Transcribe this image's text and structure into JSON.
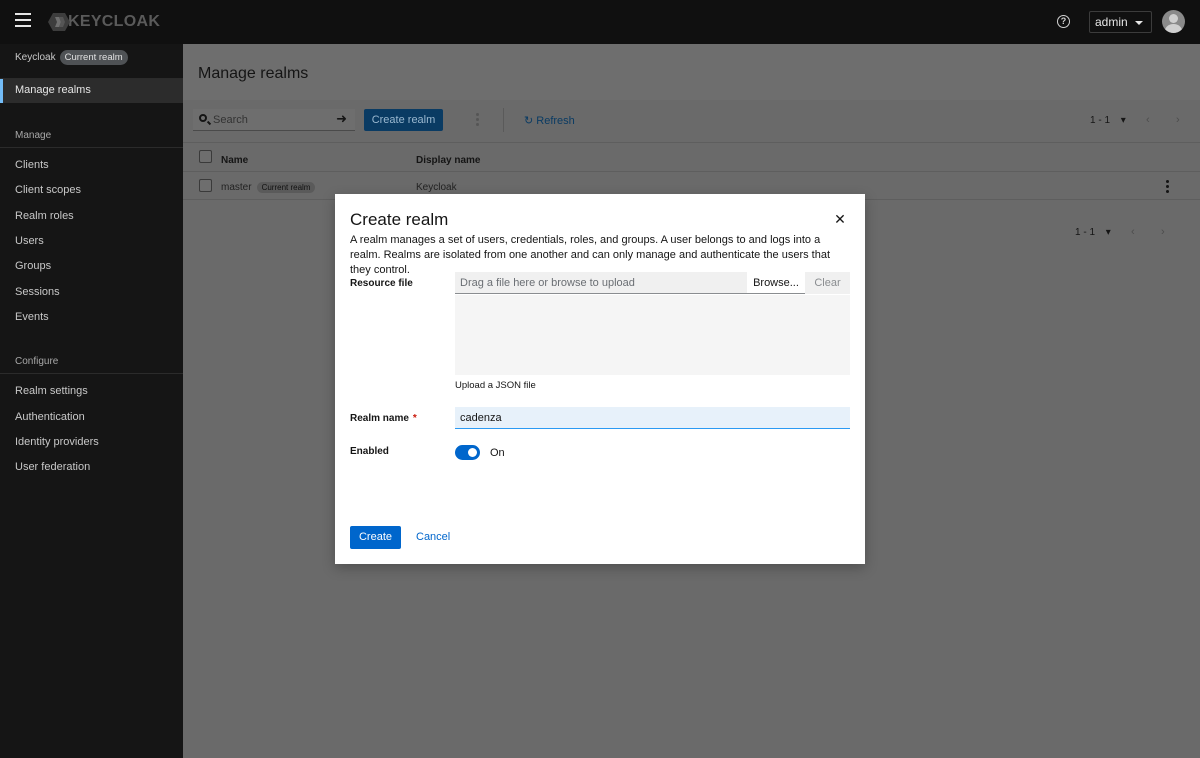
{
  "masthead": {
    "brand": "KEYCLOAK",
    "user": "admin"
  },
  "sidebar": {
    "realm_name": "Keycloak",
    "realm_badge": "Current realm",
    "active_item": "Manage realms",
    "sections": [
      {
        "title": "Manage",
        "items": [
          "Clients",
          "Client scopes",
          "Realm roles",
          "Users",
          "Groups",
          "Sessions",
          "Events"
        ]
      },
      {
        "title": "Configure",
        "items": [
          "Realm settings",
          "Authentication",
          "Identity providers",
          "User federation"
        ]
      }
    ]
  },
  "main": {
    "title": "Manage realms",
    "toolbar": {
      "search_placeholder": "Search",
      "create_label": "Create realm",
      "refresh_label": "Refresh",
      "pagination": "1 - 1"
    },
    "table": {
      "columns": [
        "Name",
        "Display name"
      ],
      "rows": [
        {
          "name": "master",
          "badge": "Current realm",
          "display_name": "Keycloak"
        }
      ]
    },
    "pagination_bottom": "1 - 1"
  },
  "modal": {
    "title": "Create realm",
    "description": "A realm manages a set of users, credentials, roles, and groups. A user belongs to and logs into a realm. Realms are isolated from one another and can only manage and authenticate the users that they control.",
    "resource_file": {
      "label": "Resource file",
      "placeholder": "Drag a file here or browse to upload",
      "browse_label": "Browse...",
      "clear_label": "Clear",
      "helper": "Upload a JSON file"
    },
    "realm_name": {
      "label": "Realm name",
      "required_mark": "*",
      "value": "cadenza"
    },
    "enabled": {
      "label": "Enabled",
      "state_label": "On"
    },
    "create_label": "Create",
    "cancel_label": "Cancel"
  }
}
